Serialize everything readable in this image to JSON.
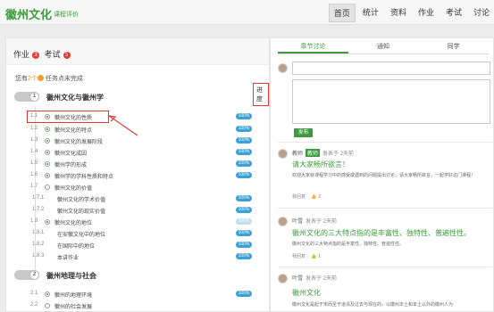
{
  "header": {
    "logo": "徽州文化",
    "logo_sub": "课程评价",
    "nav": [
      "首页",
      "统计",
      "资料",
      "作业",
      "考试",
      "讨论"
    ]
  },
  "left": {
    "homework_label": "作业",
    "homework_count": "3",
    "exam_label": "考试",
    "exam_count": "5",
    "todo_pre": "您有",
    "todo_count": "2个",
    "todo_post": "任务点未完成",
    "progress_btn": "进度",
    "chapters": [
      {
        "num": "1",
        "title": "徽州文化与徽州学"
      },
      {
        "num": "2",
        "title": "徽州地理与社会"
      }
    ],
    "rows": [
      {
        "num": "1.1",
        "label": "徽州文化的性质",
        "pct": "100%"
      },
      {
        "num": "1.2",
        "label": "徽州文化的特点",
        "pct": "100%"
      },
      {
        "num": "1.3",
        "label": "徽州文化的发展阶段",
        "pct": "100%"
      },
      {
        "num": "1.4",
        "label": "徽州文化成因",
        "pct": "100%"
      },
      {
        "num": "1.5",
        "label": "徽州学的形成",
        "pct": "100%"
      },
      {
        "num": "1.6",
        "label": "徽州学的学科性质和特点",
        "pct": "100%"
      },
      {
        "num": "1.7",
        "label": "徽州文化的价值",
        "pct": ""
      },
      {
        "num": "1.7.1",
        "label": "徽州文化的学术价值",
        "pct": "100%"
      },
      {
        "num": "1.7.2",
        "label": "徽州文化的现实价值",
        "pct": "100%"
      },
      {
        "num": "1.8",
        "label": "徽州文化的地位",
        "pct": "100%"
      },
      {
        "num": "1.8.1",
        "label": "在安徽文化中的地位",
        "pct": "100%"
      },
      {
        "num": "1.8.2",
        "label": "在国际中的地位",
        "pct": "100%"
      },
      {
        "num": "1.8.3",
        "label": "本讲作业",
        "pct": "100%"
      },
      {
        "num": "2.1",
        "label": "徽州的地理环境",
        "pct": "100%"
      },
      {
        "num": "2.2",
        "label": "徽州的社会发展",
        "pct": ""
      }
    ]
  },
  "right": {
    "tabs": [
      "章节讨论",
      "通知",
      "同学"
    ],
    "post_button": "发布",
    "posts": [
      {
        "author": "教师",
        "role": "教师",
        "time": "发表于 2天前",
        "title": "请大家畅所欲言！",
        "body": "欢迎大家就课程学习中的感受或遇到的问题提出讨论，请大家畅所欲言，一起学好这门课程！",
        "reply": "我回复",
        "likes": "2"
      },
      {
        "author": "叶雪",
        "role": "",
        "time": "发表于 2天前",
        "title": "徽州文化的三大特点指的是丰富性、独特性、普遍性性。",
        "body": "徽州文化的三大特点指的是丰富性、独特性、普遍性性。",
        "reply": "我回复",
        "likes": "1"
      },
      {
        "author": "叶雪",
        "role": "",
        "time": "发表于 2天前",
        "title": "徽州文化",
        "body": "徽州文化是起于宋而至于道清及过去与现在的，以徽州本土和本土以外的徽州人为",
        "reply": "",
        "likes": ""
      }
    ]
  },
  "colors": {
    "accent": "#3d9a3d",
    "badge": "#e53935",
    "pct": "#3aa0d6"
  }
}
